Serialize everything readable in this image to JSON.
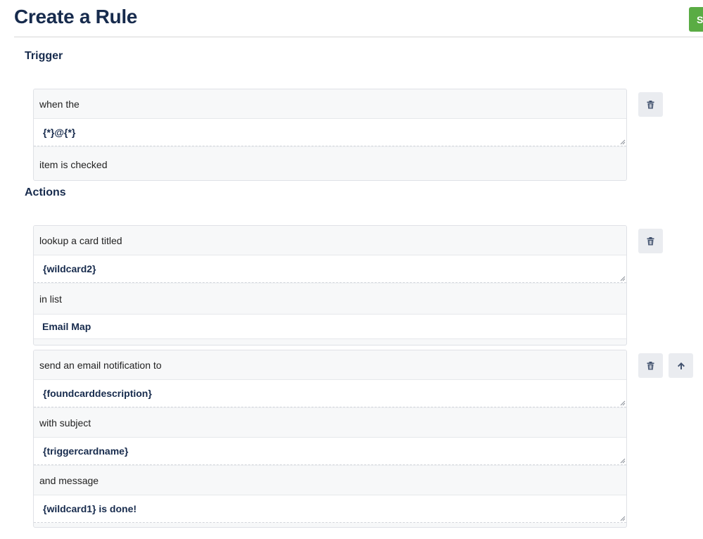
{
  "header": {
    "title": "Create a Rule",
    "save_label": "S"
  },
  "trigger": {
    "heading": "Trigger",
    "rows": {
      "label_1": "when the",
      "input_1": "{*}@{*}",
      "label_2": "item is checked"
    }
  },
  "actions": {
    "heading": "Actions",
    "lookup": {
      "label_1": "lookup a card titled",
      "input_1": "{wildcard2}",
      "label_2": "in list",
      "select_1": "Email Map"
    },
    "email": {
      "label_1": "send an email notification to",
      "input_1": "{foundcarddescription}",
      "label_2": "with subject",
      "input_2": "{triggercardname}",
      "label_3": "and message",
      "input_3": "{wildcard1} is done!"
    }
  },
  "icons": {
    "delete": "trash-icon",
    "move_up": "arrow-up-icon",
    "resize": "resize-grip-icon"
  },
  "colors": {
    "accent_green": "#5aac44",
    "title_navy": "#172b4d"
  }
}
